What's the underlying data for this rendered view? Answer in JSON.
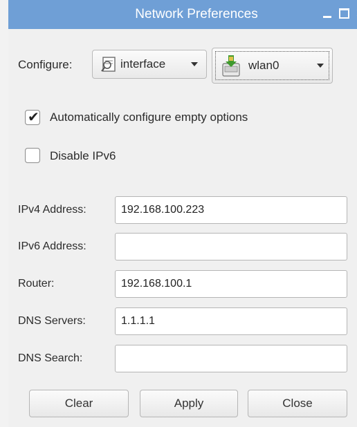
{
  "window": {
    "title": "Network Preferences",
    "controls": {
      "minimize": "minimize-icon",
      "maximize": "maximize-icon",
      "close": "close-icon",
      "close_glyph": "✕"
    },
    "titlebar_color": "#6f9fd6"
  },
  "configure": {
    "label": "Configure:",
    "type_value": "interface",
    "type_icon": "interface-icon",
    "device_value": "wlan0",
    "device_icon": "network-card-icon"
  },
  "options": {
    "auto_configure": {
      "label": "Automatically configure empty options",
      "checked": true,
      "mark": "✔"
    },
    "disable_ipv6": {
      "label": "Disable IPv6",
      "checked": false,
      "mark": ""
    }
  },
  "fields": {
    "ipv4": {
      "label": "IPv4 Address:",
      "value": "192.168.100.223"
    },
    "ipv6": {
      "label": "IPv6 Address:",
      "value": ""
    },
    "router": {
      "label": "Router:",
      "value": "192.168.100.1"
    },
    "dns_servers": {
      "label": "DNS Servers:",
      "value": "1.1.1.1"
    },
    "dns_search": {
      "label": "DNS Search:",
      "value": ""
    }
  },
  "buttons": {
    "clear": "Clear",
    "apply": "Apply",
    "close": "Close"
  }
}
